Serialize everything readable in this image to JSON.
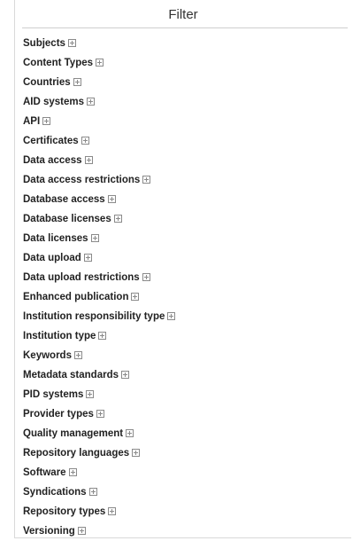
{
  "filter_panel": {
    "title": "Filter",
    "items": [
      {
        "label": "Subjects",
        "icon": "expand-plus-icon"
      },
      {
        "label": "Content Types",
        "icon": "expand-plus-icon"
      },
      {
        "label": "Countries",
        "icon": "expand-plus-icon"
      },
      {
        "label": "AID systems",
        "icon": "expand-plus-icon"
      },
      {
        "label": "API",
        "icon": "expand-plus-icon"
      },
      {
        "label": "Certificates",
        "icon": "expand-plus-icon"
      },
      {
        "label": "Data access",
        "icon": "expand-plus-icon"
      },
      {
        "label": "Data access restrictions",
        "icon": "expand-plus-icon"
      },
      {
        "label": "Database access",
        "icon": "expand-plus-icon"
      },
      {
        "label": "Database licenses",
        "icon": "expand-plus-icon"
      },
      {
        "label": "Data licenses",
        "icon": "expand-plus-icon"
      },
      {
        "label": "Data upload",
        "icon": "expand-plus-icon"
      },
      {
        "label": "Data upload restrictions",
        "icon": "expand-plus-icon"
      },
      {
        "label": "Enhanced publication",
        "icon": "expand-plus-icon"
      },
      {
        "label": "Institution responsibility type",
        "icon": "expand-plus-icon"
      },
      {
        "label": "Institution type",
        "icon": "expand-plus-icon"
      },
      {
        "label": "Keywords",
        "icon": "expand-plus-icon"
      },
      {
        "label": "Metadata standards",
        "icon": "expand-plus-icon"
      },
      {
        "label": "PID systems",
        "icon": "expand-plus-icon"
      },
      {
        "label": "Provider types",
        "icon": "expand-plus-icon"
      },
      {
        "label": "Quality management",
        "icon": "expand-plus-icon"
      },
      {
        "label": "Repository languages",
        "icon": "expand-plus-icon"
      },
      {
        "label": "Software",
        "icon": "expand-plus-icon"
      },
      {
        "label": "Syndications",
        "icon": "expand-plus-icon"
      },
      {
        "label": "Repository types",
        "icon": "expand-plus-icon"
      },
      {
        "label": "Versioning",
        "icon": "expand-plus-icon"
      }
    ]
  },
  "colors": {
    "text": "#222222",
    "title": "#333333",
    "border": "#d9d9d9",
    "icon": "#8a8a8a"
  }
}
